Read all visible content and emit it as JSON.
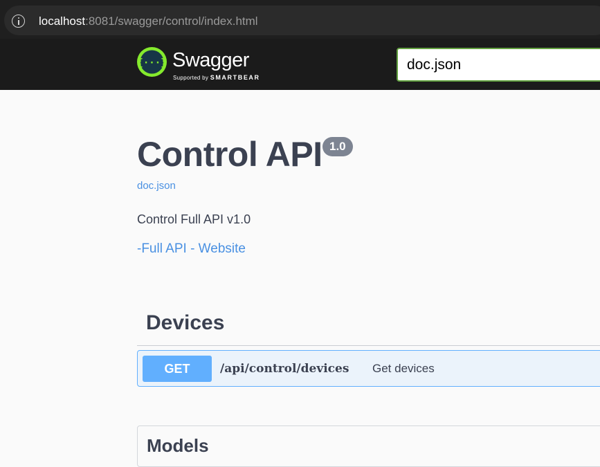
{
  "browser": {
    "url_host": "localhost",
    "url_rest": ":8081/swagger/control/index.html"
  },
  "topbar": {
    "logo_text": "Swagger",
    "logo_sub_prefix": "Supported by ",
    "logo_sub_brand": "SMARTBEAR",
    "logo_glyph": "{···}",
    "spec_url_value": "doc.json",
    "accent_color": "#85ea2d"
  },
  "info": {
    "title": "Control API",
    "version": "1.0",
    "spec_link": "doc.json",
    "description": "Control Full API v1.0",
    "website_link": "-Full API - Website"
  },
  "tags": [
    {
      "name": "Devices",
      "operations": [
        {
          "method": "GET",
          "path": "/api/control/devices",
          "summary": "Get devices",
          "method_color": "#61affe"
        }
      ]
    }
  ],
  "models": {
    "title": "Models"
  }
}
